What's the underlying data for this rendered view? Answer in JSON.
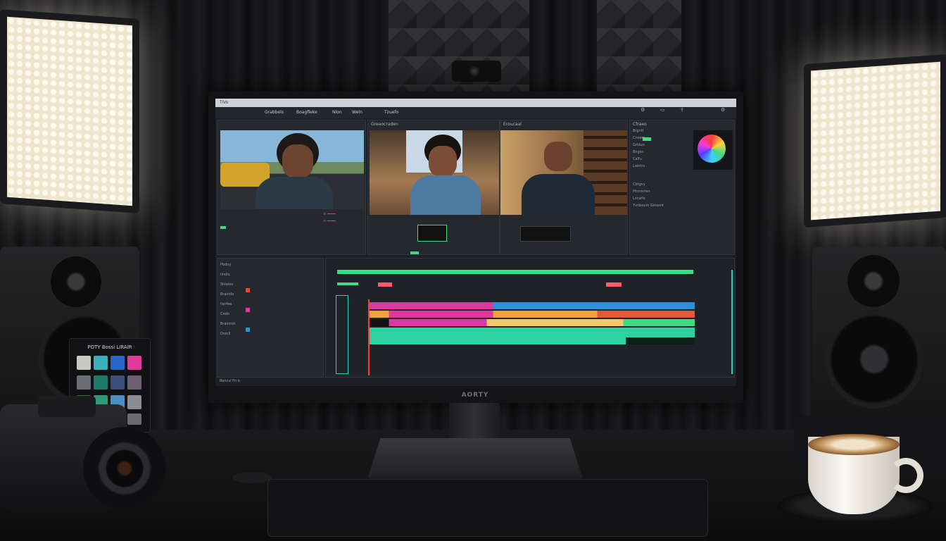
{
  "monitor": {
    "brand": "AORTY"
  },
  "color_checker": {
    "label": "POTY Bossi LIRAIR"
  },
  "editor": {
    "window_title": "TiVo",
    "menu": [
      "Grabbels",
      "Boagfleke",
      "Nlon",
      "Weln",
      "Tzuefo"
    ],
    "viewer_left": {
      "title": "Greaocraden"
    },
    "viewer_right": {
      "title": "Eroucaal"
    },
    "inspector": {
      "title": "Cfraeo",
      "rows": [
        "Brgntl",
        "Cnoem",
        "Grldun",
        "Bngsn",
        "Calfu",
        "Lalntrs"
      ],
      "section2": [
        "Cbtgvy",
        "Ptnneclan",
        "Lorarfe",
        "Yvnbouin Gelasnt"
      ]
    },
    "timeline": {
      "tracks_left": [
        "Pbdvy",
        "Ilnolu",
        "Shlatec",
        "Brainde",
        "Iterfee",
        "Cndn",
        "Brainmit",
        "Drecil"
      ],
      "bottom_status": "Rencvl  Fn b"
    }
  },
  "colors": {
    "accent_green": "#3ddc84",
    "clip_blue": "#2e8fd8",
    "clip_magenta": "#e0379e",
    "clip_orange": "#f0a53a",
    "clip_teal": "#2ed1a0",
    "playhead": "#ff3b3b"
  }
}
